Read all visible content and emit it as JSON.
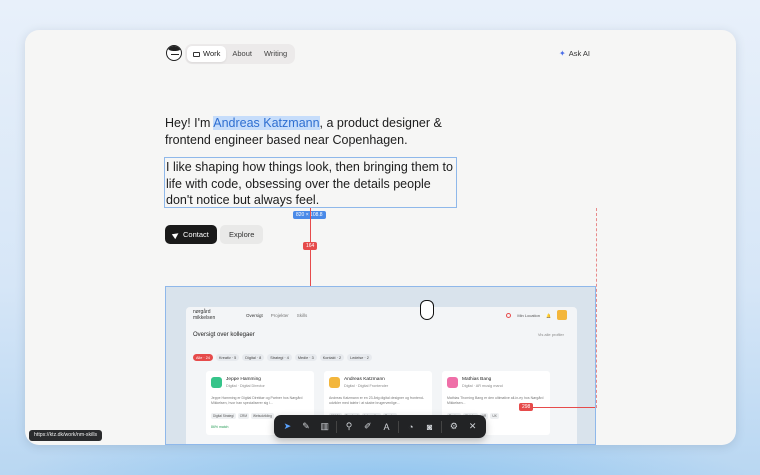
{
  "nav": {
    "tabs": [
      {
        "label": "Work",
        "active": true
      },
      {
        "label": "About",
        "active": false
      },
      {
        "label": "Writing",
        "active": false
      }
    ],
    "ask_ai": "Ask AI"
  },
  "hero": {
    "intro_before": "Hey! I'm ",
    "name": "Andreas Katzmann",
    "intro_after": ", a product designer & frontend engineer based near Copenhagen.",
    "paragraph": "I like shaping how things look, then bringing them to life with code, obsessing over the details people don't notice but always feel."
  },
  "measure": {
    "dimensions": "820 × 108.8",
    "vertical_gap": "164",
    "horizontal_gap": "298"
  },
  "buttons": {
    "contact": "Contact",
    "explore": "Explore"
  },
  "preview": {
    "logo_line1": "nørgård",
    "logo_line2": "mikkelsen",
    "nav": [
      "Oversigt",
      "Projekter",
      "Skills"
    ],
    "status": "Min Location",
    "title": "Oversigt over kollegaer",
    "view_profiles": "Vis alle profiler",
    "chips": [
      "Alle · 24",
      "Kreativ · 5",
      "Digital · 8",
      "Strategi · 4",
      "Medie · 3",
      "Kontakt · 2",
      "Ledelse · 2"
    ],
    "cards": [
      {
        "name": "Jeppe Hamming",
        "role": "Digital · Digital Director",
        "desc": "Jeppe Hamming er Digital Direktør og Partner hos Nørgård Mikkelsen, hvor han specialiserer sig i...",
        "tags": [
          "Digital Strategi",
          "CRM",
          "Webudvikling"
        ],
        "match": "86% match",
        "color": "#36c48a"
      },
      {
        "name": "Andreas Katzmann",
        "role": "Digital · Digital Frontender",
        "desc": "Andreas Katzmann er en 23-årig digital designer og frontend-udvikler med talebr i at skabe brugervenlige...",
        "tags": [
          "UI/UX",
          "Frontend",
          "Interaction",
          "Design"
        ],
        "match": "",
        "color": "#f3b63c"
      },
      {
        "name": "Mathias Bang",
        "role": "Digital · AR musig mand",
        "desc": "Mathias Thorning Bang er den ultimative all-in-ey hos Nørgård Mikkelsen...",
        "tags": [
          "Design",
          "Webd...",
          "AR",
          "UX"
        ],
        "match": "",
        "color": "#ef6fa8"
      }
    ]
  },
  "toolbar": {
    "tools": [
      "select-icon",
      "pen-icon",
      "columns-icon",
      "share-icon",
      "pencil-icon",
      "text-icon",
      "timer-icon",
      "camera-icon",
      "settings-icon",
      "close-icon"
    ],
    "text_glyph": "A"
  },
  "statusbar": {
    "url": "https://ktz.dk/work/nm-skills"
  }
}
